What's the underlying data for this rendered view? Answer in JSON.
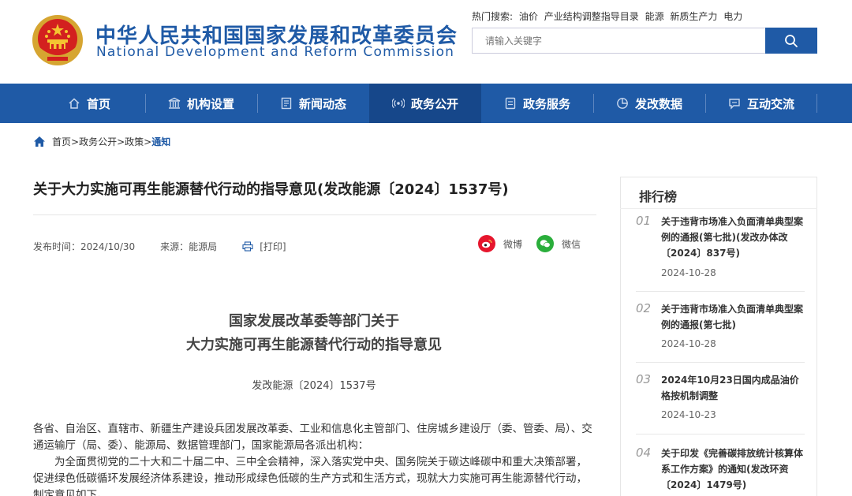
{
  "header": {
    "title_cn": "中华人民共和国国家发展和改革委员会",
    "title_en": "National Development and Reform Commission",
    "hot_search_label": "热门搜索:",
    "hot_search_terms": [
      "油价",
      "产业结构调整指导目录",
      "能源",
      "新质生产力",
      "电力"
    ],
    "search_placeholder": "请输入关键字"
  },
  "nav": {
    "items": [
      {
        "label": "首页",
        "icon": "home-icon"
      },
      {
        "label": "机构设置",
        "icon": "building-icon"
      },
      {
        "label": "新闻动态",
        "icon": "news-icon"
      },
      {
        "label": "政务公开",
        "icon": "broadcast-icon",
        "active": true
      },
      {
        "label": "政务服务",
        "icon": "document-icon"
      },
      {
        "label": "发改数据",
        "icon": "pie-chart-icon"
      },
      {
        "label": "互动交流",
        "icon": "chat-icon"
      }
    ],
    "active_color": "#16478a",
    "bar_color": "#1f5aa6"
  },
  "breadcrumb": {
    "items": [
      "首页",
      "政务公开",
      "政策"
    ],
    "separator": " > ",
    "current": "通知"
  },
  "article": {
    "title": "关于大力实施可再生能源替代行动的指导意见(发改能源〔2024〕1537号)",
    "publish_label": "发布时间：2024/10/30",
    "source_label": "来源：能源局",
    "print_label": "[打印]",
    "share_weibo": "微博",
    "share_wechat": "微信",
    "doc_heading_line1": "国家发展改革委等部门关于",
    "doc_heading_line2": "大力实施可再生能源替代行动的指导意见",
    "doc_number": "发改能源〔2024〕1537号",
    "paragraph1": "各省、自治区、直辖市、新疆生产建设兵团发展改革委、工业和信息化主管部门、住房城乡建设厅（委、管委、局）、交通运输厅（局、委）、能源局、数据管理部门，国家能源局各派出机构：",
    "paragraph2": "为全面贯彻党的二十大和二十届二中、三中全会精神，深入落实党中央、国务院关于碳达峰碳中和重大决策部署，促进绿色低碳循环发展经济体系建设，推动形成绿色低碳的生产方式和生活方式，现就大力实施可再生能源替代行动，制定意见如下。"
  },
  "sidebar": {
    "title": "排行榜",
    "items": [
      {
        "num": "01",
        "text": "关于违背市场准入负面清单典型案例的通报(第七批)(发改办体改〔2024〕837号)",
        "date": "2024-10-28"
      },
      {
        "num": "02",
        "text": "关于违背市场准入负面清单典型案例的通报(第七批)",
        "date": "2024-10-28"
      },
      {
        "num": "03",
        "text": "2024年10月23日国内成品油价格按机制调整",
        "date": "2024-10-23"
      },
      {
        "num": "04",
        "text": "关于印发《完善碳排放统计核算体系工作方案》的通知(发改环资〔2024〕1479号)",
        "date": ""
      }
    ]
  }
}
